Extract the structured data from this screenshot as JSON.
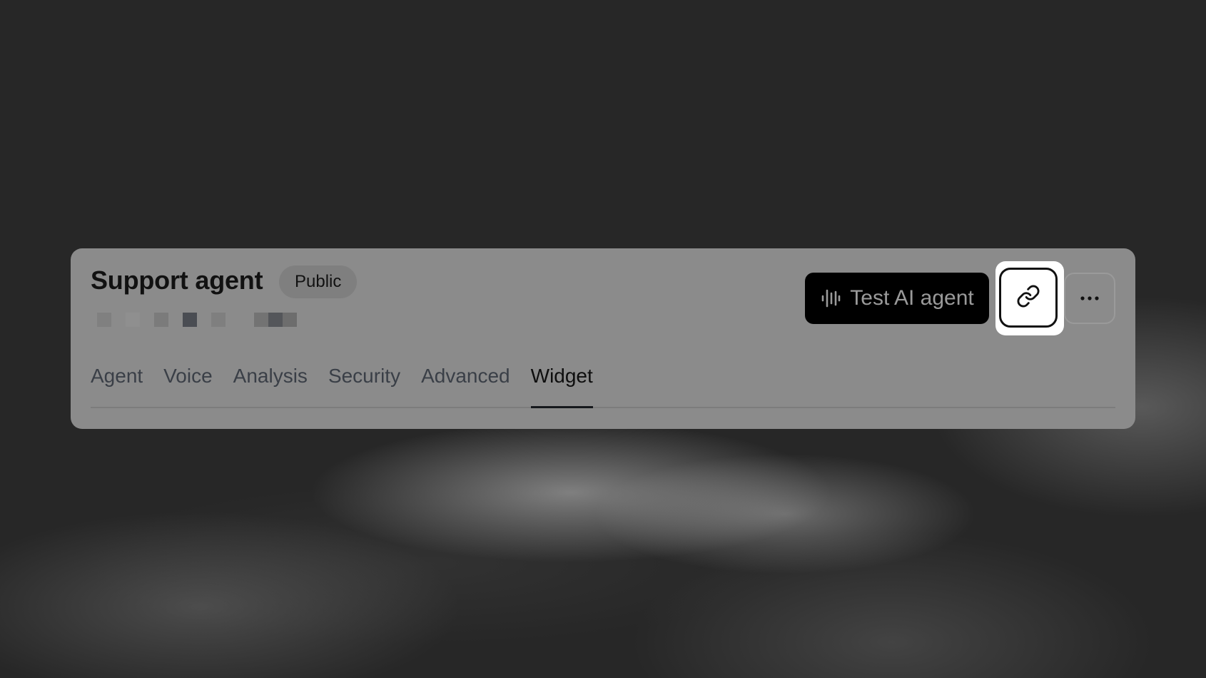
{
  "header": {
    "title": "Support agent",
    "visibility_badge": "Public"
  },
  "obscured_id": {
    "blocks": [
      {
        "color": "#808080"
      },
      {
        "color": "#8f8f8f"
      },
      {
        "color": "#7b7b7b"
      },
      {
        "color": "#4a4d53"
      },
      {
        "color": "#7f7f7f"
      },
      {
        "color": "#737373"
      },
      {
        "color": "#54565a"
      },
      {
        "color": "#6d6d6d"
      }
    ]
  },
  "actions": {
    "test_button": {
      "label": "Test AI agent",
      "icon": "audio-wave-icon"
    },
    "copy_link_button": {
      "icon": "link-icon",
      "highlighted": true
    },
    "more_button": {
      "icon": "more-horizontal-icon"
    }
  },
  "tabs": [
    {
      "label": "Agent",
      "active": false
    },
    {
      "label": "Voice",
      "active": false
    },
    {
      "label": "Analysis",
      "active": false
    },
    {
      "label": "Security",
      "active": false
    },
    {
      "label": "Advanced",
      "active": false
    },
    {
      "label": "Widget",
      "active": true
    }
  ],
  "colors": {
    "panel": "#8b8b8b",
    "primary_button": "#000000",
    "highlight": "#ffffff"
  }
}
